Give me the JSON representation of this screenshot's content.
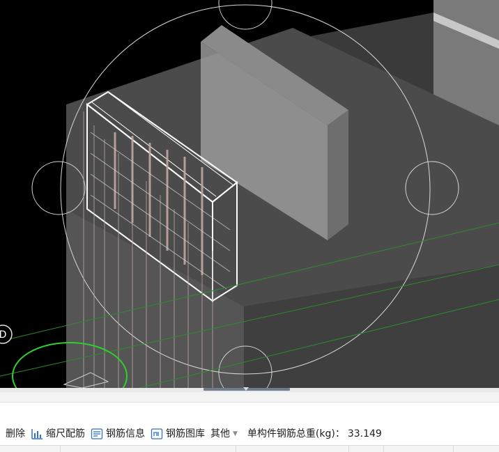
{
  "viewport": {
    "background": "#000000",
    "view_cube": "view-orbit-circle",
    "axis_marker_label": "D"
  },
  "toolbar": {
    "delete_label": "删除",
    "scale_rebar_label": "缩尺配筋",
    "rebar_info_label": "钢筋信息",
    "rebar_library_label": "钢筋图库",
    "other_label": "其他",
    "total_weight_label": "单构件钢筋总重(kg)：",
    "total_weight_value": "33.149"
  },
  "icons": {
    "scale_rebar": "bar-chart-icon",
    "rebar_info": "info-list-icon",
    "rebar_library": "library-icon",
    "dropdown": "dropdown-caret-icon"
  },
  "colors": {
    "viewport_bg": "#000000",
    "accent_blue": "#2f6fd0",
    "splitter_handle": "#6f7d8c"
  }
}
